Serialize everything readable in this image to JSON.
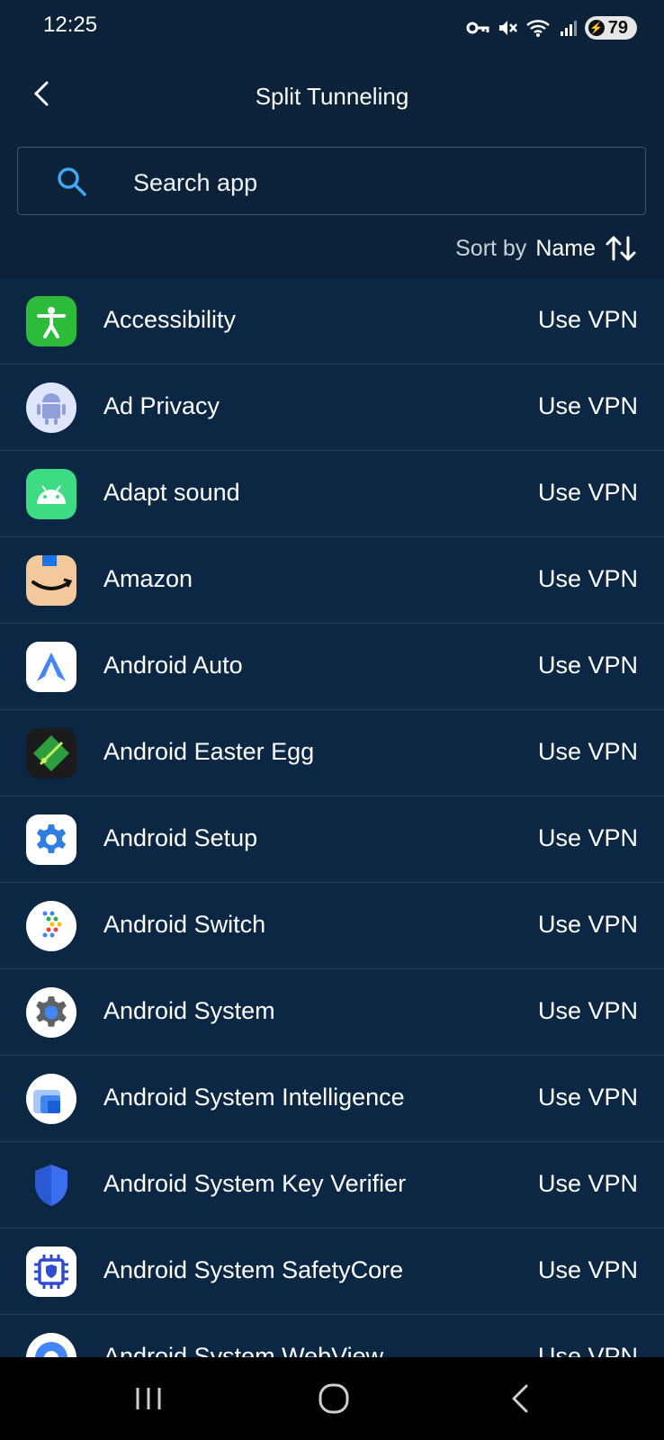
{
  "status_bar": {
    "time": "12:25",
    "battery": "79"
  },
  "header": {
    "title": "Split Tunneling"
  },
  "search": {
    "placeholder": "Search app"
  },
  "sort": {
    "label": "Sort by",
    "value": "Name"
  },
  "apps": [
    {
      "name": "Accessibility",
      "mode": "Use VPN",
      "icon": "accessibility-icon"
    },
    {
      "name": "Ad Privacy",
      "mode": "Use VPN",
      "icon": "android-robot-icon"
    },
    {
      "name": "Adapt sound",
      "mode": "Use VPN",
      "icon": "adapt-sound-icon"
    },
    {
      "name": "Amazon",
      "mode": "Use VPN",
      "icon": "amazon-icon"
    },
    {
      "name": "Android Auto",
      "mode": "Use VPN",
      "icon": "android-auto-icon"
    },
    {
      "name": "Android Easter Egg",
      "mode": "Use VPN",
      "icon": "easter-egg-icon"
    },
    {
      "name": "Android Setup",
      "mode": "Use VPN",
      "icon": "setup-gear-icon"
    },
    {
      "name": "Android Switch",
      "mode": "Use VPN",
      "icon": "switch-dots-icon"
    },
    {
      "name": "Android System",
      "mode": "Use VPN",
      "icon": "system-gear-icon"
    },
    {
      "name": "Android System Intelligence",
      "mode": "Use VPN",
      "icon": "intelligence-icon"
    },
    {
      "name": "Android System Key Verifier",
      "mode": "Use VPN",
      "icon": "shield-icon"
    },
    {
      "name": "Android System SafetyCore",
      "mode": "Use VPN",
      "icon": "safetycore-chip-icon"
    },
    {
      "name": "Android System WebView",
      "mode": "Use VPN",
      "icon": "webview-icon"
    }
  ]
}
